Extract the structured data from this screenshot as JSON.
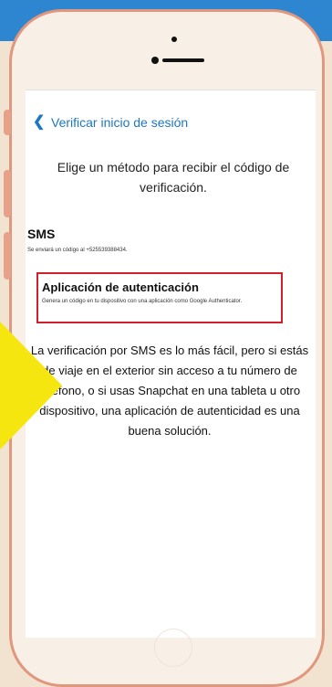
{
  "nav": {
    "title": "Verificar inicio de sesión",
    "back_icon": "chevron-left-icon"
  },
  "intro": {
    "text": "Elige un método para recibir el código de verificación."
  },
  "sms": {
    "title": "SMS",
    "subtitle": "Se enviará un código al +525539388434."
  },
  "auth": {
    "title": "Aplicación de autenticación",
    "subtitle": "Genera un código en tu dispositivo con una aplicación como Google Authenticator."
  },
  "explanation": {
    "text": "La verificación por SMS es lo más fácil, pero si estás de viaje en el exterior sin acceso a tu número de teléfono, o si usas Snapchat en una tableta u otro dispositivo, una aplicación de autenticidad es una buena solución."
  },
  "colors": {
    "accent": "#1d77c2",
    "highlight_border": "#d21f2e",
    "phone_frame": "#e1967e",
    "background_top": "#2e86d0",
    "background_bottom": "#f1e3cf",
    "pointer": "#f5e60f"
  }
}
